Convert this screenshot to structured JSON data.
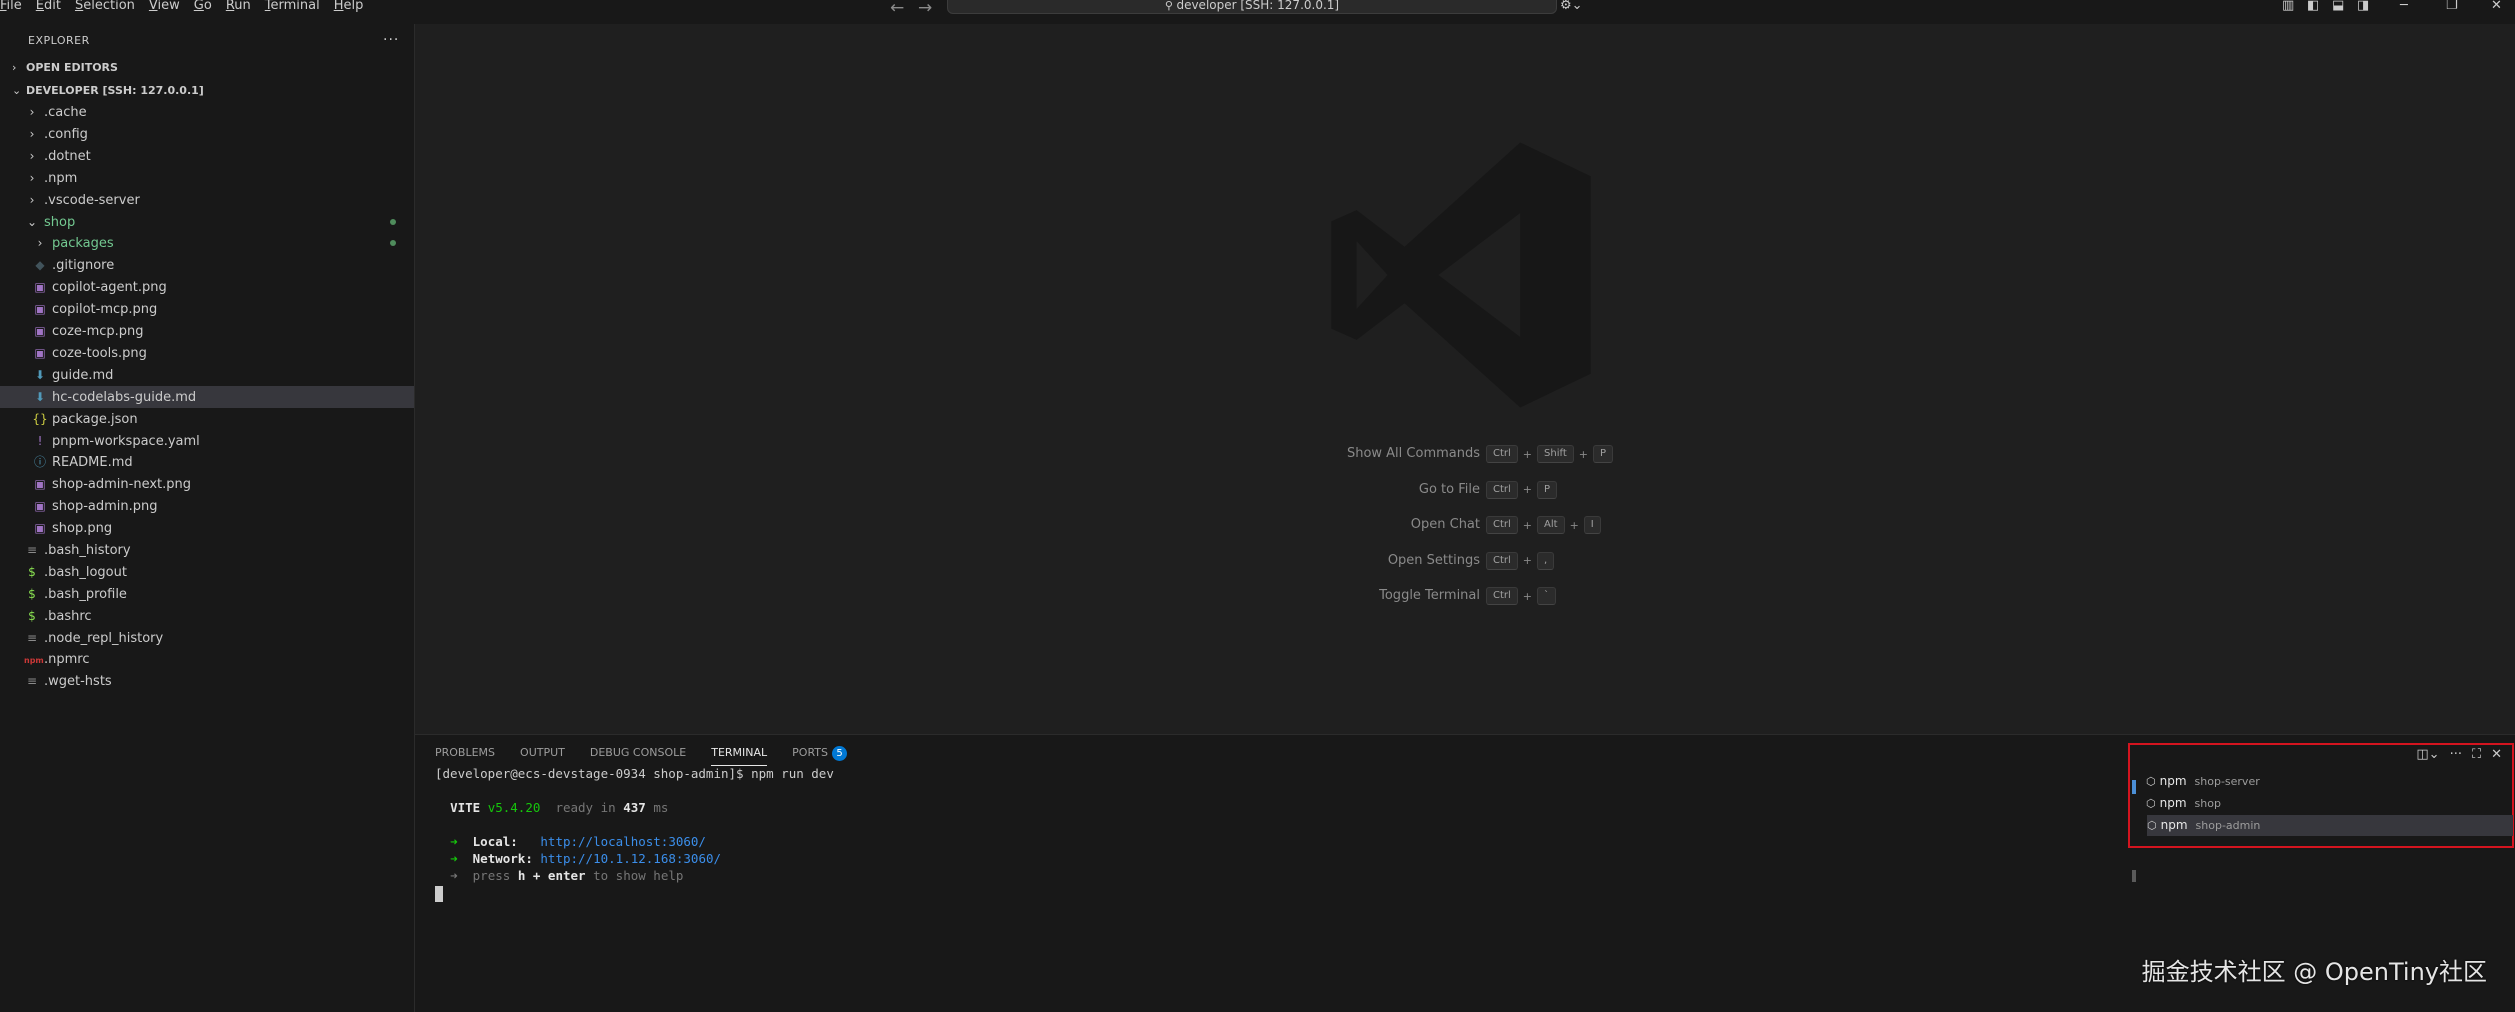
{
  "menu": [
    "File",
    "Edit",
    "Selection",
    "View",
    "Go",
    "Run",
    "Terminal",
    "Help"
  ],
  "command_center": "developer [SSH: 127.0.0.1]",
  "sidebar": {
    "header": "EXPLORER",
    "open_editors": "OPEN EDITORS",
    "workspace": "DEVELOPER [SSH: 127.0.0.1]",
    "items": [
      {
        "label": ".cache",
        "indent": 1,
        "kind": "folder"
      },
      {
        "label": ".config",
        "indent": 1,
        "kind": "folder"
      },
      {
        "label": ".dotnet",
        "indent": 1,
        "kind": "folder"
      },
      {
        "label": ".npm",
        "indent": 1,
        "kind": "folder"
      },
      {
        "label": ".vscode-server",
        "indent": 1,
        "kind": "folder"
      },
      {
        "label": "shop",
        "indent": 1,
        "kind": "folder-open",
        "modified": true
      },
      {
        "label": "packages",
        "indent": 2,
        "kind": "folder",
        "modified": true
      },
      {
        "label": ".gitignore",
        "indent": 2,
        "kind": "git"
      },
      {
        "label": "copilot-agent.png",
        "indent": 2,
        "kind": "image"
      },
      {
        "label": "copilot-mcp.png",
        "indent": 2,
        "kind": "image"
      },
      {
        "label": "coze-mcp.png",
        "indent": 2,
        "kind": "image"
      },
      {
        "label": "coze-tools.png",
        "indent": 2,
        "kind": "image"
      },
      {
        "label": "guide.md",
        "indent": 2,
        "kind": "md"
      },
      {
        "label": "hc-codelabs-guide.md",
        "indent": 2,
        "kind": "md",
        "selected": true
      },
      {
        "label": "package.json",
        "indent": 2,
        "kind": "json"
      },
      {
        "label": "pnpm-workspace.yaml",
        "indent": 2,
        "kind": "yaml"
      },
      {
        "label": "README.md",
        "indent": 2,
        "kind": "info"
      },
      {
        "label": "shop-admin-next.png",
        "indent": 2,
        "kind": "image"
      },
      {
        "label": "shop-admin.png",
        "indent": 2,
        "kind": "image"
      },
      {
        "label": "shop.png",
        "indent": 2,
        "kind": "image"
      },
      {
        "label": ".bash_history",
        "indent": 1,
        "kind": "text"
      },
      {
        "label": ".bash_logout",
        "indent": 1,
        "kind": "shell"
      },
      {
        "label": ".bash_profile",
        "indent": 1,
        "kind": "shell"
      },
      {
        "label": ".bashrc",
        "indent": 1,
        "kind": "shell"
      },
      {
        "label": ".node_repl_history",
        "indent": 1,
        "kind": "text"
      },
      {
        "label": ".npmrc",
        "indent": 1,
        "kind": "npm"
      },
      {
        "label": ".wget-hsts",
        "indent": 1,
        "kind": "text"
      }
    ]
  },
  "shortcuts": [
    {
      "label": "Show All Commands",
      "keys": [
        "Ctrl",
        "Shift",
        "P"
      ]
    },
    {
      "label": "Go to File",
      "keys": [
        "Ctrl",
        "P"
      ]
    },
    {
      "label": "Open Chat",
      "keys": [
        "Ctrl",
        "Alt",
        "I"
      ]
    },
    {
      "label": "Open Settings",
      "keys": [
        "Ctrl",
        ","
      ]
    },
    {
      "label": "Toggle Terminal",
      "keys": [
        "Ctrl",
        "`"
      ]
    }
  ],
  "panel": {
    "tabs": [
      "PROBLEMS",
      "OUTPUT",
      "DEBUG CONSOLE",
      "TERMINAL",
      "PORTS"
    ],
    "active_tab": "TERMINAL",
    "ports_badge": "5"
  },
  "terminal": {
    "prompt": "[developer@ecs-devstage-0934 shop-admin]$ npm run dev",
    "vite": "VITE",
    "vite_version": "v5.4.20",
    "ready_in": "ready in",
    "ready_ms": "437",
    "ms": "ms",
    "arrow": "➜",
    "local_label": "Local:",
    "local_url": "http://localhost:3060/",
    "network_label": "Network:",
    "network_url": "http://10.1.12.168:3060/",
    "help_prefix": "press",
    "help_key": "h + enter",
    "help_suffix": "to show help"
  },
  "terminal_list": [
    {
      "name": "npm",
      "sub": "shop-server"
    },
    {
      "name": "npm",
      "sub": "shop"
    },
    {
      "name": "npm",
      "sub": "shop-admin",
      "active": true
    }
  ],
  "watermark": "掘金技术社区 @ OpenTiny社区"
}
